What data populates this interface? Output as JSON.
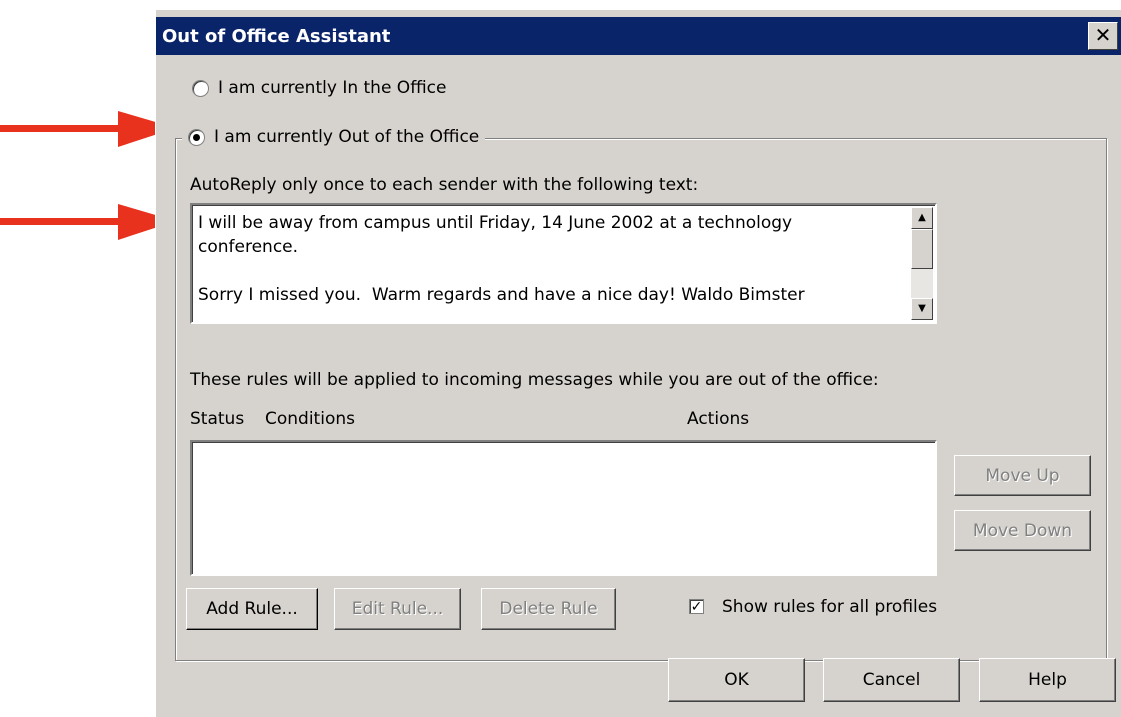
{
  "colors": {
    "titlebar": "#0a246a",
    "dialog_bg": "#d6d3ce",
    "arrow": "#e8321e"
  },
  "title": "Out of Office Assistant",
  "close_glyph": "✕",
  "radio_in_office": {
    "label": "I am currently In the Office",
    "checked": false
  },
  "radio_out_office": {
    "label": "I am currently Out of the Office",
    "checked": true
  },
  "autoreply": {
    "label": "AutoReply only once to each sender with the following text:",
    "text": "I will be away from campus until Friday, 14 June 2002 at a technology\nconference.\n\nSorry I missed you.  Warm regards and have a nice day! Waldo Bimster"
  },
  "rules": {
    "intro": "These rules will be applied to incoming messages while you are out of the office:",
    "col_status": "Status",
    "col_conditions": "Conditions",
    "col_actions": "Actions",
    "move_up": "Move Up",
    "move_down": "Move Down",
    "add_rule": "Add Rule...",
    "edit_rule": "Edit Rule...",
    "delete_rule": "Delete Rule",
    "show_all_profiles": {
      "label": "Show rules for all profiles",
      "checked": true
    }
  },
  "footer": {
    "ok": "OK",
    "cancel": "Cancel",
    "help": "Help"
  },
  "icons": {
    "arrow_1": "arrow-right-icon",
    "arrow_2": "arrow-right-icon",
    "scroll_up": "scroll-up-icon",
    "scroll_down": "scroll-down-icon"
  }
}
